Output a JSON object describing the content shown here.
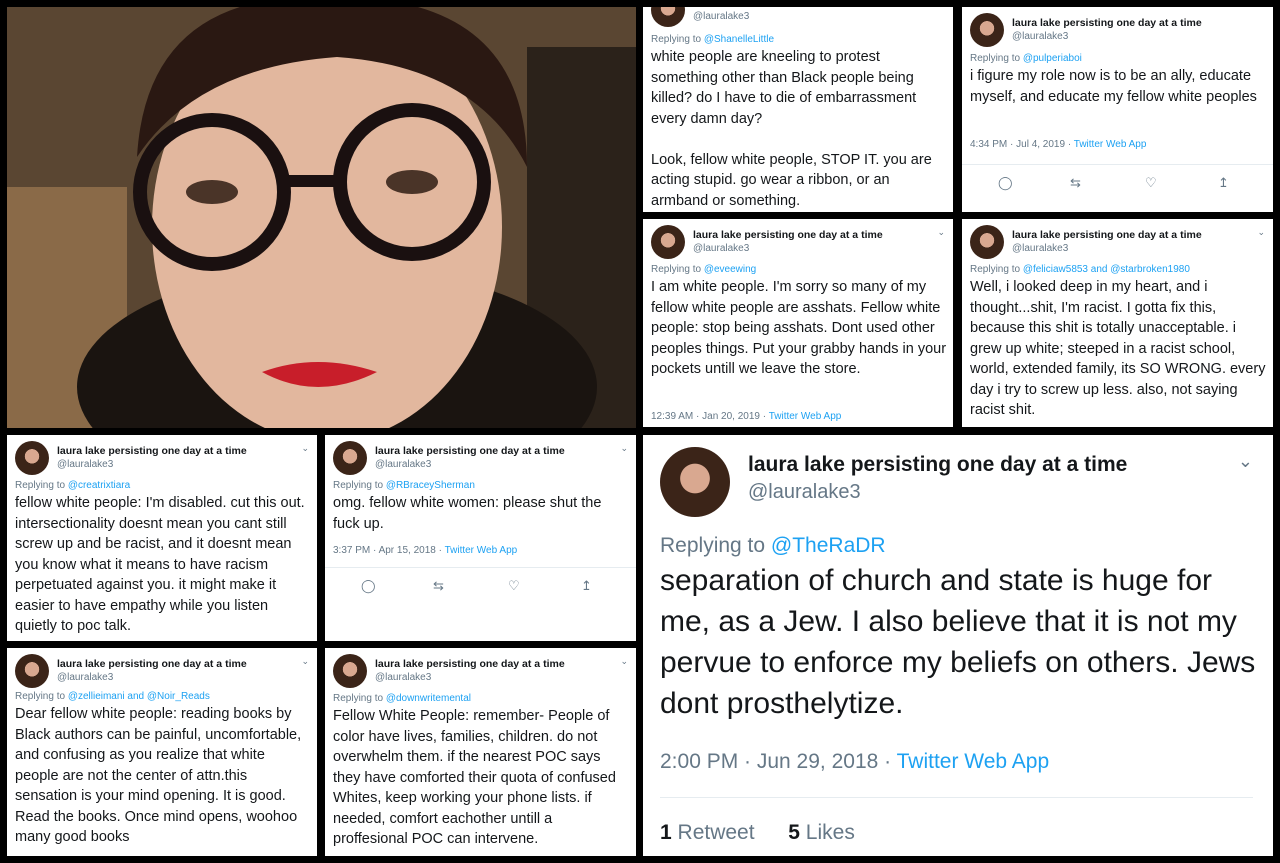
{
  "tweets": [
    {
      "name": "",
      "handle": "@lauralake3",
      "replying_prefix": "Replying to",
      "replying_to": "@ShanelleLittle",
      "text": "white people are kneeling to protest something other than Black people being killed? do I have to die of embarrassment every damn day?\n\nLook, fellow white people, STOP IT. you are acting stupid. go wear a ribbon, or an armband or something.",
      "time": "",
      "app": ""
    },
    {
      "name": "laura lake persisting one day at a time",
      "handle": "@lauralake3",
      "replying_prefix": "Replying to",
      "replying_to": "@pulperiaboi",
      "text": "i figure my role now is to be an ally, educate myself, and educate my fellow white peoples",
      "time": "4:34 PM · Jul 4, 2019 ·",
      "app": "Twitter Web App"
    },
    {
      "name": "laura lake persisting one day at a time",
      "handle": "@lauralake3",
      "replying_prefix": "Replying to",
      "replying_to": "@eveewing",
      "text": "I am white people. I'm sorry so many of my fellow white people are asshats. Fellow white people: stop being asshats. Dont used other peoples things. Put your grabby hands in your pockets untill we leave the store.",
      "time": "12:39 AM · Jan 20, 2019 ·",
      "app": "Twitter Web App"
    },
    {
      "name": "laura lake persisting one day at a time",
      "handle": "@lauralake3",
      "replying_prefix": "Replying to",
      "replying_to": "@feliciaw5853 and @starbroken1980",
      "text": "Well, i looked deep in my heart, and i thought...shit, I'm racist. I gotta fix this, because this shit is totally unacceptable. i grew up white; steeped in a racist  school, world, extended family, its SO WRONG. every day i try to screw up less. also, not saying racist shit.",
      "time": "",
      "app": ""
    },
    {
      "name": "laura lake persisting one day at a time",
      "handle": "@lauralake3",
      "replying_prefix": "Replying to",
      "replying_to": "@creatrixtiara",
      "text": "fellow white people: I'm disabled.  cut this out. intersectionality doesnt mean you cant still screw up and be racist, and it doesnt mean you know what it means to have racism perpetuated against you. it might make it easier to have empathy while you listen quietly to poc talk.",
      "time": "",
      "app": ""
    },
    {
      "name": "laura lake persisting one day at a time",
      "handle": "@lauralake3",
      "replying_prefix": "Replying to",
      "replying_to": "@RBraceySherman",
      "text": "omg. fellow white women: please shut the fuck up.",
      "time": "3:37 PM · Apr 15, 2018 ·",
      "app": "Twitter Web App"
    },
    {
      "name": "laura lake persisting one day at a time",
      "handle": "@lauralake3",
      "replying_prefix": "Replying to",
      "replying_to": "@zellieimani and @Noir_Reads",
      "text": "Dear fellow white people: reading books by Black authors can be painful, uncomfortable, and confusing as you realize that white people are not the center of attn.this sensation is your mind opening. It is good. Read the books. Once mind opens, woohoo many good books",
      "time": "",
      "app": ""
    },
    {
      "name": "laura lake persisting one day at a time",
      "handle": "@lauralake3",
      "replying_prefix": "Replying to",
      "replying_to": "@downwritemental",
      "text": "Fellow White People: remember- People of color have lives, families, children. do not overwhelm them. if the nearest POC says they have comforted their quota of confused Whites, keep working your phone lists. if needed, comfort eachother untill a proffesional POC can intervene.",
      "time": "",
      "app": ""
    },
    {
      "name": "laura lake persisting one day at a time",
      "handle": "@lauralake3",
      "replying_prefix": "Replying to",
      "replying_to": "@TheRaDR",
      "text": "separation of church and state is huge for me, as a Jew. I also believe that it is not my pervue to enforce my beliefs on others. Jews dont prosthelytize.",
      "time": "2:00 PM · Jun 29, 2018 ·",
      "app": "Twitter Web App",
      "retweet_count": "1",
      "retweet_label": "Retweet",
      "likes_count": "5",
      "likes_label": "Likes"
    }
  ],
  "icons": [
    "reply-icon",
    "retweet-icon",
    "like-icon",
    "share-icon",
    "chevron-down-icon"
  ]
}
